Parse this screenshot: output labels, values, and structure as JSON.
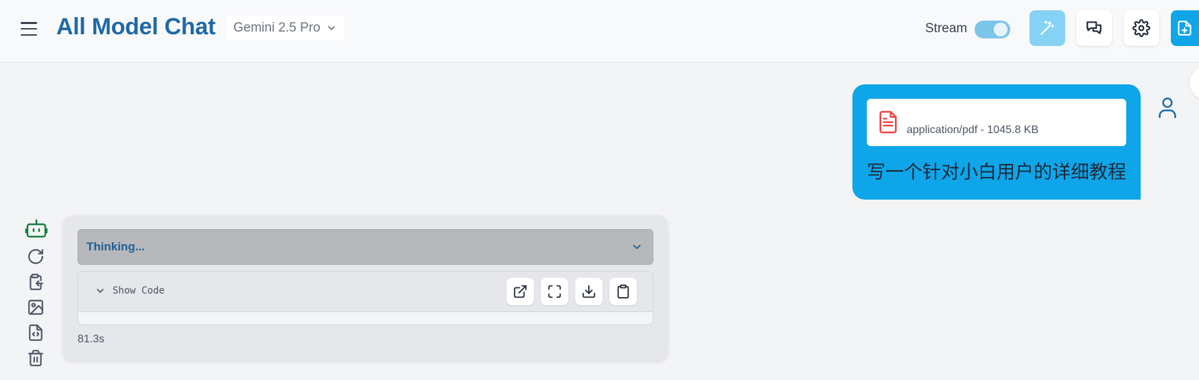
{
  "header": {
    "app_title": "All Model Chat",
    "model_name": "Gemini 2.5 Pro",
    "stream_label": "Stream",
    "stream_enabled": true
  },
  "user_message": {
    "attachment": {
      "meta": "application/pdf - 1045.8 KB",
      "icon": "pdf-file-icon"
    },
    "text": "写一个针对小白用户的详细教程"
  },
  "bot_message": {
    "thinking_label": "Thinking...",
    "code_block": {
      "toggle_label": "Show Code",
      "actions": [
        "open-external",
        "fullscreen",
        "download",
        "copy"
      ]
    },
    "timing": "81.3s"
  },
  "colors": {
    "brand": "#1f6aa6",
    "accent": "#0ea5e9",
    "bot_icon": "#15803d",
    "pdf_icon": "#ef4444"
  }
}
